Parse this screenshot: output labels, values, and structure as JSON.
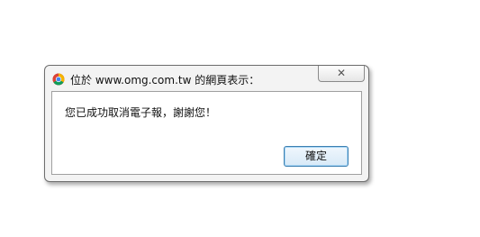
{
  "dialog": {
    "title": "位於 www.omg.com.tw 的網頁表示：",
    "close_glyph": "✕",
    "message": "您已成功取消電子報，謝謝您！",
    "ok_label": "確定"
  },
  "colors": {
    "chrome_red": "#db4437",
    "chrome_yellow": "#f4b400",
    "chrome_green": "#0f9d58",
    "chrome_blue": "#4285f4",
    "button_border": "#3c7fb1"
  },
  "icons": {
    "title_icon": "chrome-logo-icon",
    "close_icon": "close-icon"
  }
}
